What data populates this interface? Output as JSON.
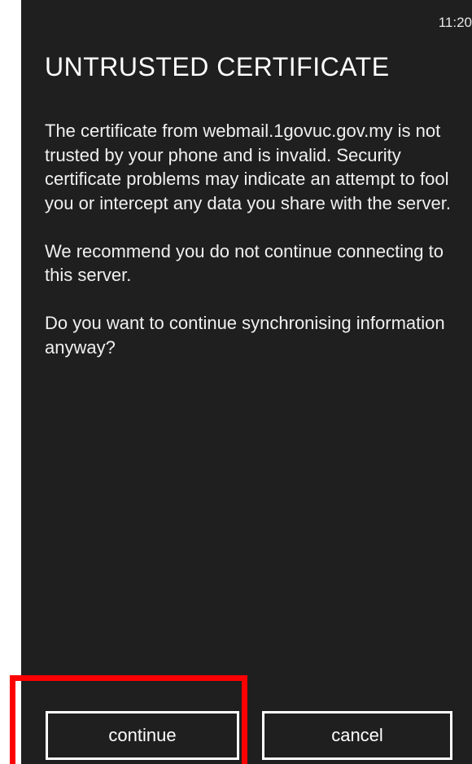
{
  "status_bar": {
    "time": "11:20"
  },
  "dialog": {
    "title": "UNTRUSTED CERTIFICATE",
    "paragraphs": [
      "The certificate from webmail.1govuc.gov.my is not trusted by your phone and is invalid. Security certificate problems may indicate an attempt to fool you or intercept any data you share with the server.",
      "We recommend you do not continue connecting to this server.",
      "Do you want to continue synchronising information anyway?"
    ],
    "buttons": {
      "continue_label": "continue",
      "cancel_label": "cancel"
    }
  },
  "colors": {
    "background": "#1f1f1f",
    "text": "#ffffff",
    "highlight": "#ff0000"
  }
}
